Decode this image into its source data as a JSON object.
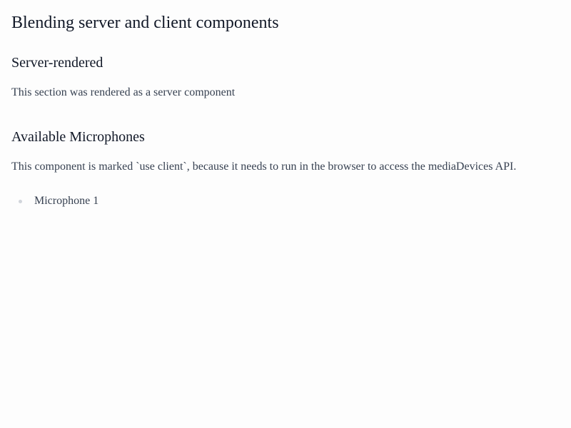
{
  "page": {
    "title": "Blending server and client components"
  },
  "server_section": {
    "title": "Server-rendered",
    "text": "This section was rendered as a server component"
  },
  "client_section": {
    "title": "Available Microphones",
    "text": "This component is marked `use client`, because it needs to run in the browser to access the mediaDevices API.",
    "microphones": [
      "Microphone 1"
    ]
  }
}
